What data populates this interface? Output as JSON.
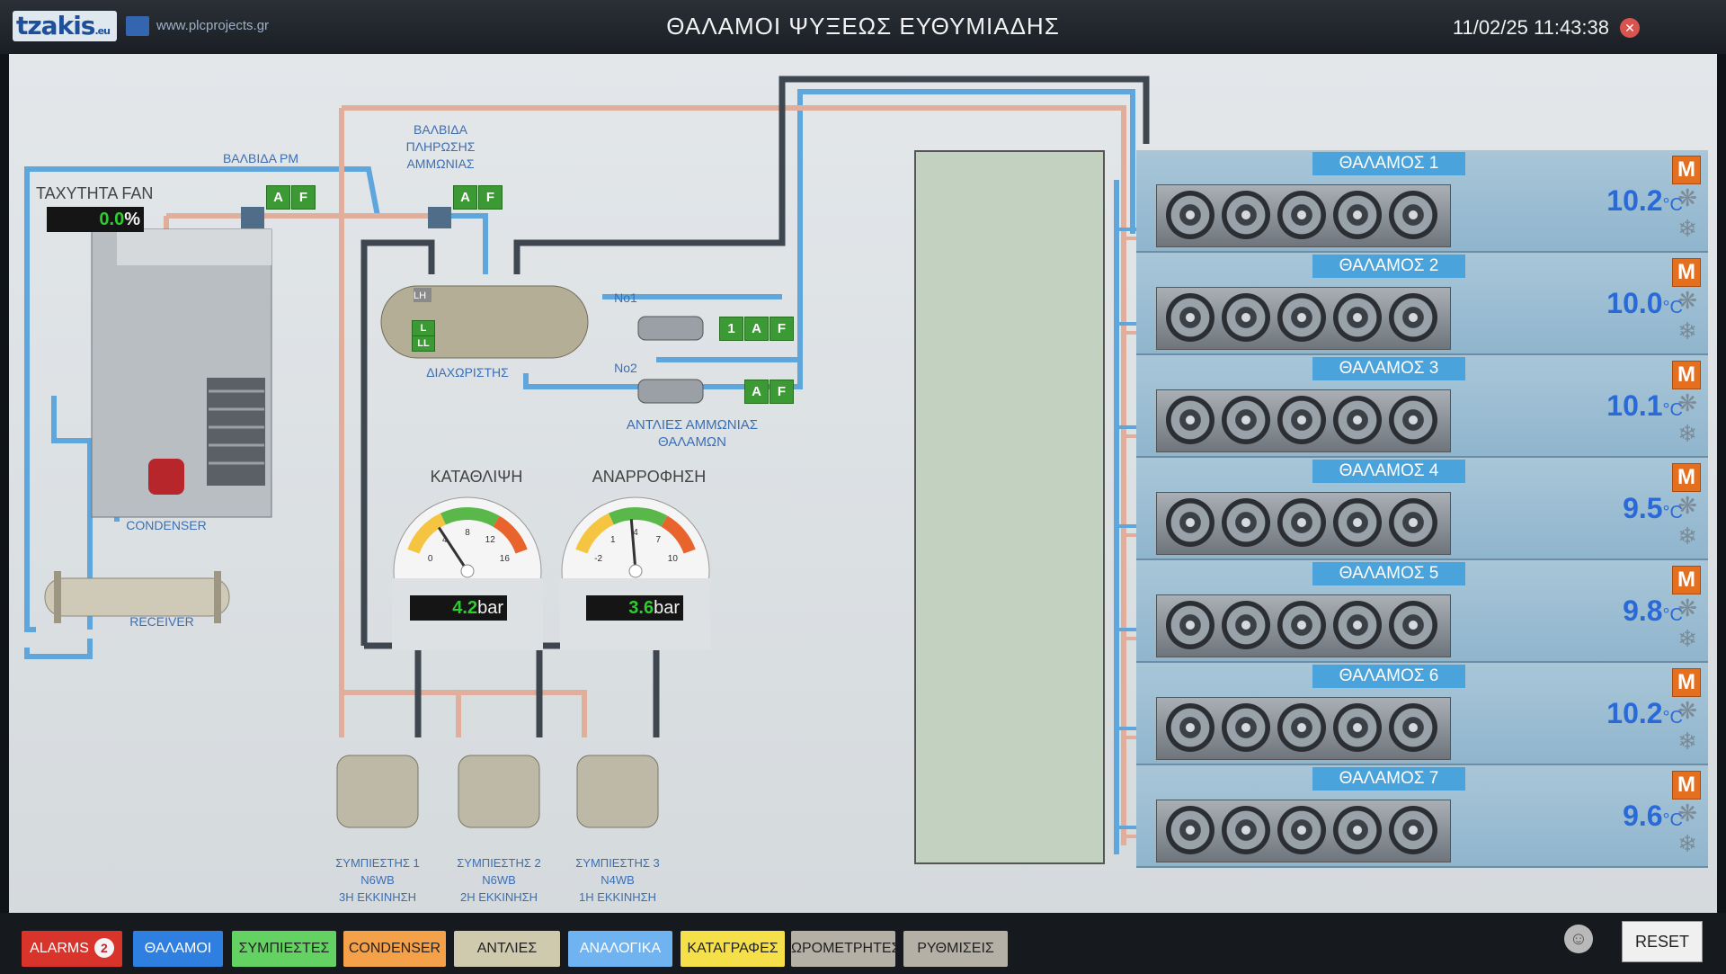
{
  "header": {
    "logo": "tzakis",
    "logo_suffix": ".eu",
    "site": "www.plcprojects.gr",
    "title": "ΘΑΛΑΜΟΙ ΨΥΞΕΩΣ ΕΥΘΥΜΙΑΔΗΣ",
    "datetime": "11/02/25 11:43:38",
    "close_icon": "close-icon"
  },
  "labels": {
    "fan_speed_title": "ΤΑΧΥΤΗΤΑ FAN",
    "fan_speed_value": "0.0",
    "fan_speed_unit": "%",
    "valve_pm": "ΒΑΛΒΙΔΑ PM",
    "fill_valve_1": "ΒΑΛΒΙΔΑ",
    "fill_valve_2": "ΠΛΗΡΩΣΗΣ",
    "fill_valve_3": "ΑΜΜΩΝΙΑΣ",
    "separator": "ΔΙΑΧΩΡΙΣΤΗΣ",
    "separator_l": "L",
    "separator_ll": "LL",
    "separator_lh": "LH",
    "condenser": "CONDENSER",
    "receiver": "RECEIVER",
    "pump_no1": "No1",
    "pump_no2": "No2",
    "pumps_1": "ΑΝΤΛΙΕΣ ΑΜΜΩΝΙΑΣ",
    "pumps_2": "ΘΑΛΑΜΩΝ",
    "pump1_number": "1",
    "btn_a": "A",
    "btn_f": "F"
  },
  "gauges": [
    {
      "title": "ΚΑΤΑΘΛΙΨΗ",
      "value": 4.2,
      "display": "4.2",
      "unit": "bar",
      "ticks": [
        "0",
        "4",
        "8",
        "12",
        "16"
      ],
      "min": 0,
      "max": 16
    },
    {
      "title": "ΑΝΑΡΡΟΦΗΣΗ",
      "value": 3.6,
      "display": "3.6",
      "unit": "bar",
      "ticks": [
        "-2",
        "1",
        "4",
        "7",
        "10"
      ],
      "min": -2,
      "max": 10
    }
  ],
  "compressors": [
    {
      "name": "ΣΥΜΠΙΕΣΤΗΣ 1",
      "model": "N6WB",
      "start": "3Η ΕΚΚΙΝΗΣΗ"
    },
    {
      "name": "ΣΥΜΠΙΕΣΤΗΣ 2",
      "model": "N6WB",
      "start": "2Η ΕΚΚΙΝΗΣΗ"
    },
    {
      "name": "ΣΥΜΠΙΕΣΤΗΣ 3",
      "model": "N4WB",
      "start": "1Η ΕΚΚΙΝΗΣΗ"
    }
  ],
  "chambers": [
    {
      "name": "ΘΑΛΑΜΟΣ 1",
      "temp": "10.2",
      "unit": "°C",
      "mode": "M"
    },
    {
      "name": "ΘΑΛΑΜΟΣ 2",
      "temp": "10.0",
      "unit": "°C",
      "mode": "M"
    },
    {
      "name": "ΘΑΛΑΜΟΣ 3",
      "temp": "10.1",
      "unit": "°C",
      "mode": "M"
    },
    {
      "name": "ΘΑΛΑΜΟΣ 4",
      "temp": "9.5",
      "unit": "°C",
      "mode": "M"
    },
    {
      "name": "ΘΑΛΑΜΟΣ 5",
      "temp": "9.8",
      "unit": "°C",
      "mode": "M"
    },
    {
      "name": "ΘΑΛΑΜΟΣ 6",
      "temp": "10.2",
      "unit": "°C",
      "mode": "M"
    },
    {
      "name": "ΘΑΛΑΜΟΣ 7",
      "temp": "9.6",
      "unit": "°C",
      "mode": "M"
    }
  ],
  "nav": {
    "alarms": "ALARMS",
    "alarm_count": "2",
    "items": [
      "ΘΑΛΑΜΟΙ",
      "ΣΥΜΠΙΕΣΤΕΣ",
      "CONDENSER",
      "ΑΝΤΛΙΕΣ",
      "ΑΝΑΛΟΓΙΚΑ",
      "ΚΑΤΑΓΡΑΦΕΣ",
      "ΩΡΟΜΕΤΡΗΤΕΣ",
      "ΡΥΘΜΙΣΕΙΣ"
    ],
    "colors": [
      "#2f7fe0",
      "#63d263",
      "#f5a14a",
      "#cfc9ae",
      "#6fb3f0",
      "#f5e04a",
      "#b5b0a6",
      "#b5b0a6"
    ],
    "alarm_color": "#d8342b",
    "user_icon": "user-icon",
    "reset": "RESET"
  }
}
